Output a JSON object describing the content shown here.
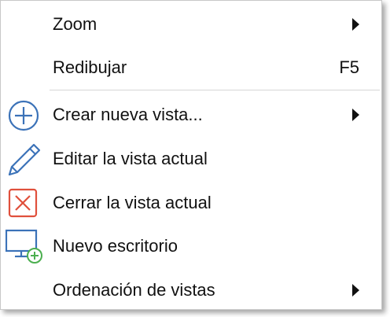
{
  "menu": {
    "items": [
      {
        "label": "Zoom",
        "has_submenu": true
      },
      {
        "label": "Redibujar",
        "shortcut": "F5"
      },
      {
        "label": "Crear nueva vista...",
        "has_submenu": true,
        "icon": "plus-circle-icon"
      },
      {
        "label": "Editar la vista actual",
        "icon": "pencil-icon"
      },
      {
        "label": "Cerrar la vista actual",
        "icon": "close-box-icon"
      },
      {
        "label": "Nuevo escritorio",
        "icon": "monitor-add-icon"
      },
      {
        "label": "Ordenación de vistas",
        "has_submenu": true
      }
    ]
  },
  "colors": {
    "icon_blue": "#3b72b8",
    "icon_red": "#e0503c",
    "icon_green": "#4caf50"
  }
}
